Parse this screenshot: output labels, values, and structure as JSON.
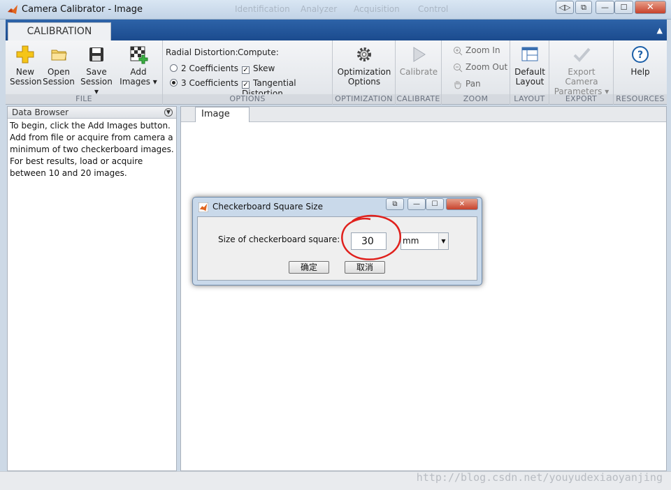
{
  "window": {
    "title": "Camera Calibrator - Image",
    "background_menu": [
      "Identification",
      "Analyzer",
      "Acquisition",
      "Control"
    ]
  },
  "tabs": {
    "active": "CALIBRATION"
  },
  "toolstrip": {
    "file": {
      "title": "FILE",
      "new_session": [
        "New",
        "Session"
      ],
      "open_session": [
        "Open",
        "Session"
      ],
      "save_session": [
        "Save",
        "Session ▾"
      ],
      "add_images": [
        "Add",
        "Images ▾"
      ]
    },
    "options": {
      "title": "OPTIONS",
      "radial_label": "Radial Distortion:",
      "compute_label": "Compute:",
      "two_coeff": "2 Coefficients",
      "three_coeff": "3 Coefficients",
      "skew": "Skew",
      "tangential": "Tangential Distortion",
      "selected_radial": "3 Coefficients",
      "skew_checked": true,
      "tangential_checked": true
    },
    "optimization": {
      "title": "OPTIMIZATION",
      "label": [
        "Optimization",
        "Options"
      ]
    },
    "calibrate": {
      "title": "CALIBRATE",
      "label": "Calibrate"
    },
    "zoom": {
      "title": "ZOOM",
      "zoom_in": "Zoom In",
      "zoom_out": "Zoom Out",
      "pan": "Pan"
    },
    "layout": {
      "title": "LAYOUT",
      "label": [
        "Default",
        "Layout"
      ]
    },
    "export": {
      "title": "EXPORT",
      "label": [
        "Export Camera",
        "Parameters ▾"
      ]
    },
    "resources": {
      "title": "RESOURCES",
      "label": "Help"
    }
  },
  "data_browser": {
    "title": "Data Browser",
    "help": "To begin, click the Add Images button. Add from file or acquire from camera a minimum of two checkerboard images. For best results, load or acquire between 10 and 20 images."
  },
  "image_panel": {
    "tab": "Image"
  },
  "dialog": {
    "title": "Checkerboard Square Size",
    "label": "Size of checkerboard square:",
    "value": "30",
    "unit": "mm",
    "ok": "确定",
    "cancel": "取消"
  },
  "watermark": "http://blog.csdn.net/youyudexiaoyanjing",
  "colors": {
    "tab_blue": "#2d63a8",
    "annotation_red": "#e0201c"
  }
}
